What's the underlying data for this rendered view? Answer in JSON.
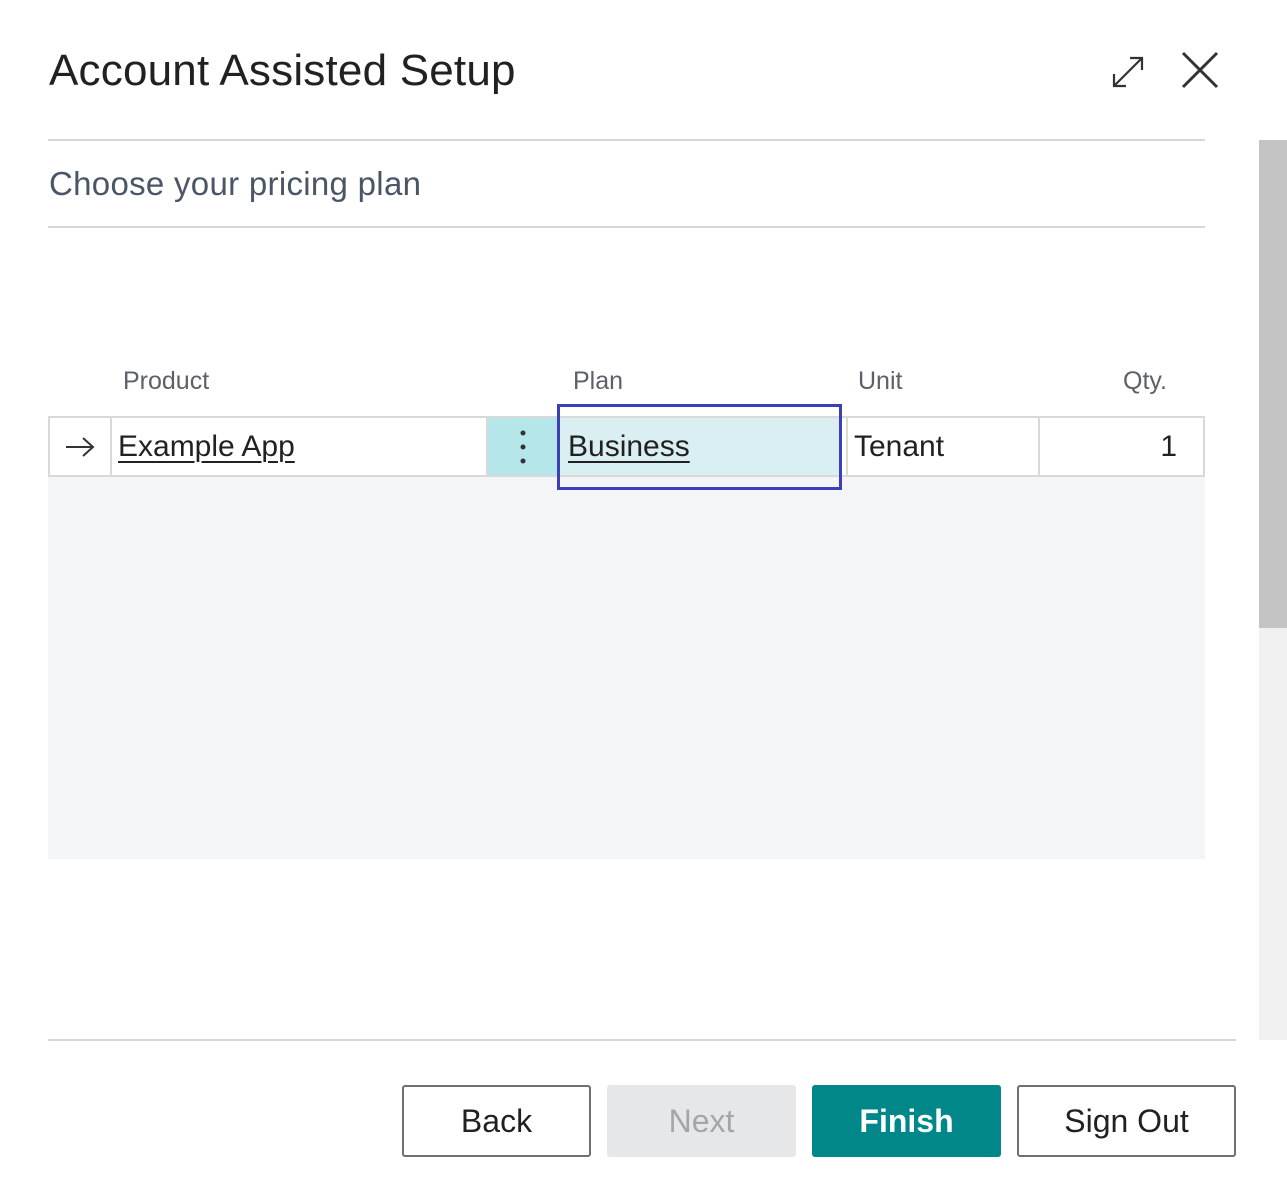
{
  "dialog": {
    "title": "Account Assisted Setup",
    "step_title": "Choose your pricing plan"
  },
  "table": {
    "columns": {
      "product": "Product",
      "plan": "Plan",
      "unit": "Unit",
      "qty": "Qty."
    },
    "rows": [
      {
        "product": "Example App",
        "plan": "Business",
        "unit": "Tenant",
        "qty": "1"
      }
    ]
  },
  "buttons": {
    "back": "Back",
    "next": "Next",
    "finish": "Finish",
    "sign_out": "Sign Out"
  },
  "icons": {
    "expand": "expand-icon",
    "close": "close-icon",
    "row_arrow": "arrow-right-icon",
    "row_menu": "more-vertical-icon"
  },
  "colors": {
    "accent": "#00878a",
    "focus_outline": "#3b3fb8",
    "selected_cell": "#d9eff1"
  }
}
